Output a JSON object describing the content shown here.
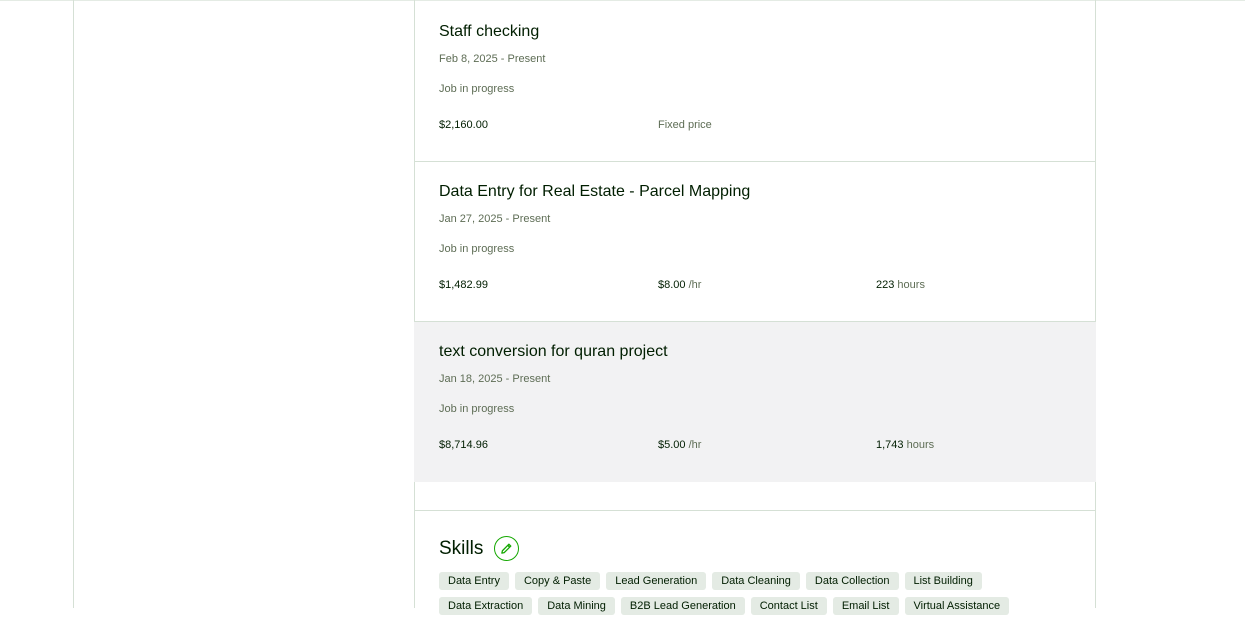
{
  "jobs": [
    {
      "title": "Staff checking",
      "dates": "Feb 8, 2025 - Present",
      "status": "Job in progress",
      "earned": "$2,160.00",
      "rate": "Fixed price",
      "rate_unit": "",
      "hours": "",
      "hours_unit": ""
    },
    {
      "title": "Data Entry for Real Estate - Parcel Mapping",
      "dates": "Jan 27, 2025 - Present",
      "status": "Job in progress",
      "earned": "$1,482.99",
      "rate": "$8.00",
      "rate_unit": "/hr",
      "hours": "223",
      "hours_unit": "hours"
    },
    {
      "title": "text conversion for quran project",
      "dates": "Jan 18, 2025 - Present",
      "status": "Job in progress",
      "earned": "$8,714.96",
      "rate": "$5.00",
      "rate_unit": "/hr",
      "hours": "1,743",
      "hours_unit": "hours"
    }
  ],
  "skills": {
    "title": "Skills",
    "edit_icon": "pencil-icon",
    "accent_color": "#14a800",
    "tags_row1": [
      "Data Entry",
      "Copy & Paste",
      "Lead Generation",
      "Data Cleaning",
      "Data Collection",
      "List Building"
    ],
    "tags_row2": [
      "Data Extraction",
      "Data Mining",
      "B2B Lead Generation",
      "Contact List",
      "Email List",
      "Virtual Assistance"
    ]
  }
}
